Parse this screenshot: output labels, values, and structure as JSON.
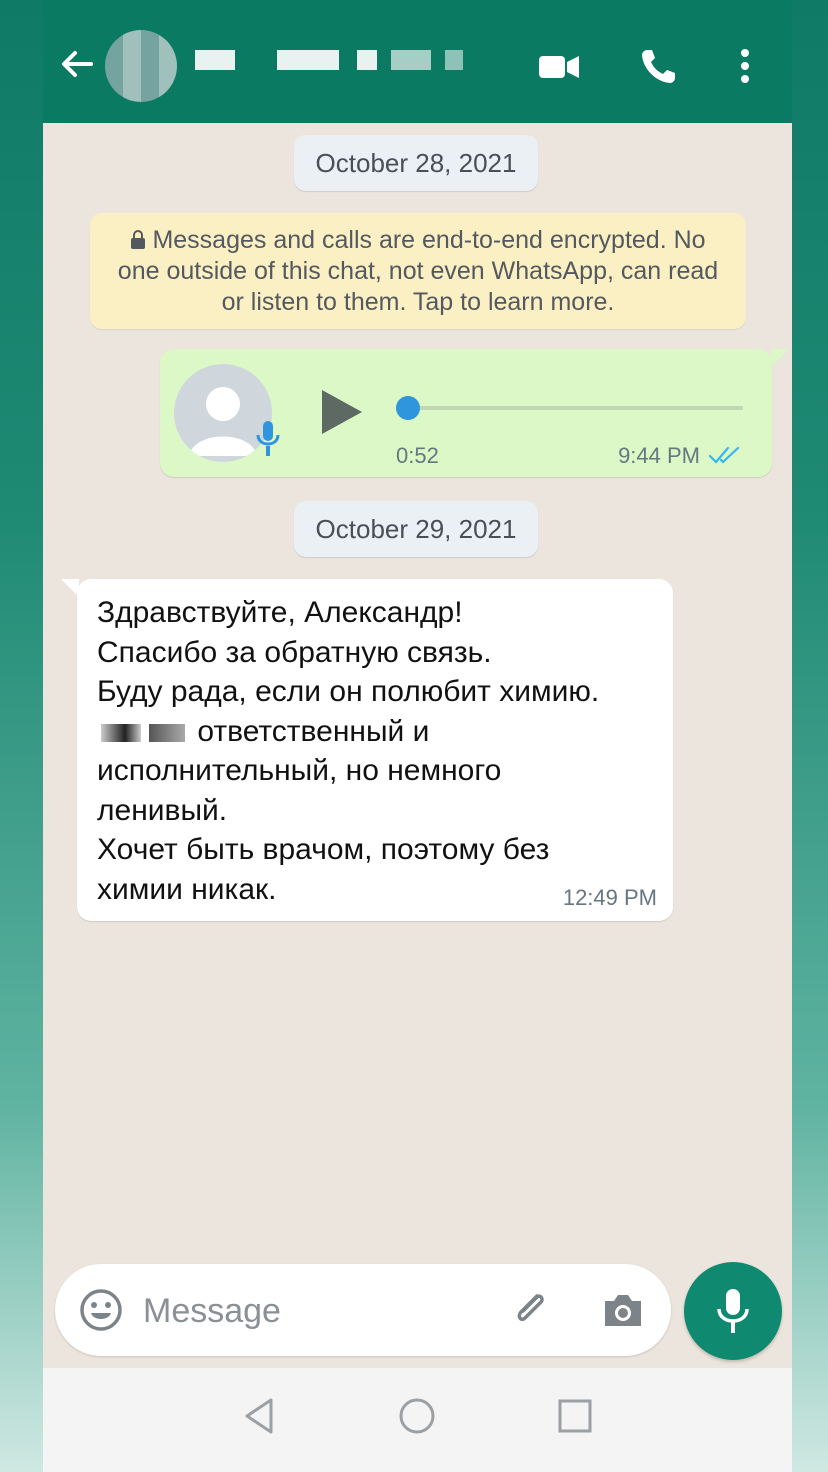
{
  "app": {
    "name": "WhatsApp"
  },
  "colors": {
    "header": "#0b7a62",
    "outgoing_bubble": "#dcf8c6",
    "incoming_bubble": "#ffffff",
    "accent": "#0f8a70",
    "tick_blue": "#34b7f1"
  },
  "header": {
    "icons": [
      "back-arrow-icon",
      "video-call-icon",
      "phone-icon",
      "more-vert-icon"
    ]
  },
  "chat": {
    "date1": "October 28, 2021",
    "encryption_notice": "Messages and calls are end-to-end encrypted. No one outside of this chat, not even WhatsApp, can read or listen to them. Tap to learn more.",
    "voice_message": {
      "duration": "0:52",
      "time": "9:44 PM",
      "progress": 0.0,
      "status": "read"
    },
    "date2": "October 29, 2021",
    "incoming": {
      "line1": "Здравствуйте, Александр!",
      "line2": "Спасибо за обратную связь.",
      "line3": "Буду рада, если он полюбит химию.",
      "line4_rest": "ответственный и",
      "line5": "исполнительный, но немного",
      "line6": "ленивый.",
      "line7": "Хочет быть врачом, поэтому без",
      "line8": "химии никак.",
      "time": "12:49 PM"
    }
  },
  "composer": {
    "placeholder": "Message"
  },
  "navbar": {
    "icons": [
      "nav-back-icon",
      "nav-home-icon",
      "nav-recents-icon"
    ]
  }
}
